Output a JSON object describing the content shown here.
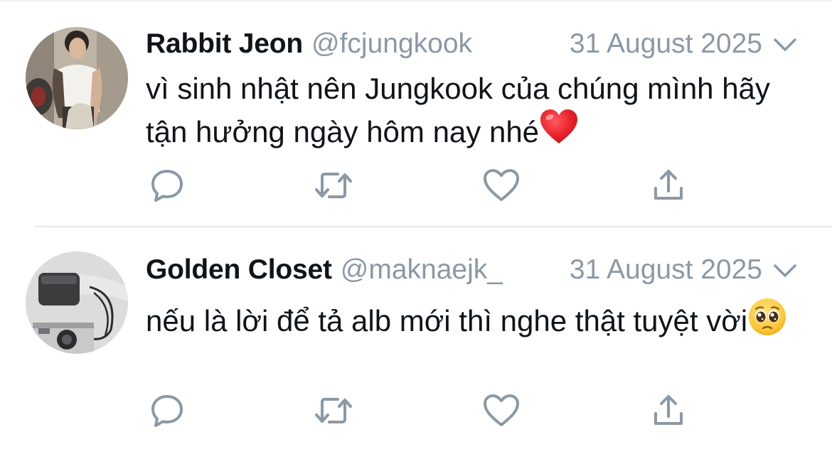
{
  "tweets": [
    {
      "display_name": "Rabbit Jeon",
      "handle": "@fcjungkook",
      "timestamp": "31 August 2025",
      "text": "vì sinh nhật nên Jungkook của chúng mình hãy tận hưởng ngày hôm nay nhé",
      "emoji": "red-heart",
      "avatar": "avatar-photo-man-tank-top",
      "actions": [
        "reply-icon",
        "retweet-icon",
        "like-icon",
        "share-icon"
      ]
    },
    {
      "display_name": "Golden Closet",
      "handle": "@maknaejk_",
      "timestamp": "31 August 2025",
      "text": "nếu là lời để tả alb mới thì nghe thật tuyệt vời",
      "emoji": "pleading-face",
      "avatar": "avatar-photo-camera-and-bag",
      "actions": [
        "reply-icon",
        "retweet-icon",
        "like-icon",
        "share-icon"
      ]
    }
  ],
  "colors": {
    "text": "#0f1419",
    "secondary": "#8b98a5",
    "icon": "#8b98a5",
    "divider": "#e6eaec"
  }
}
